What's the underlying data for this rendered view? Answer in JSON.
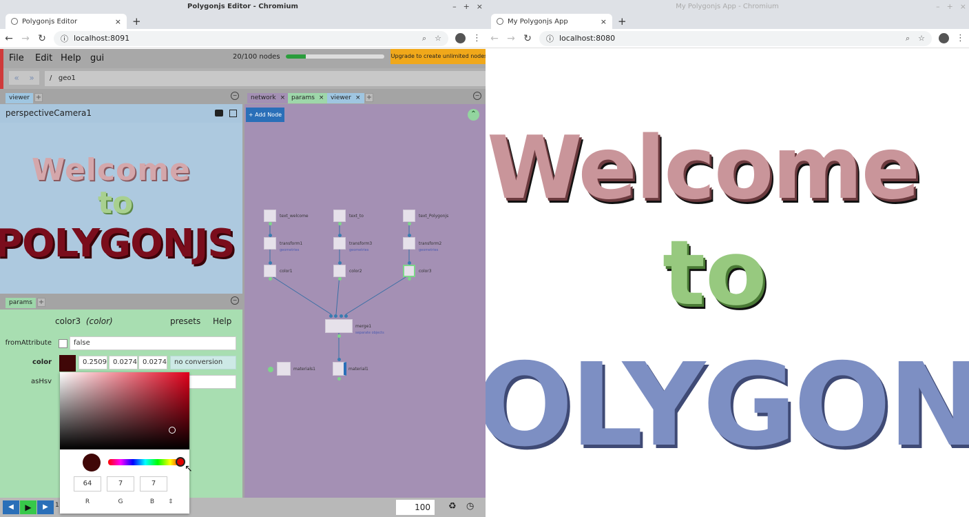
{
  "left_window": {
    "title": "Polygonjs Editor - Chromium",
    "tab_title": "Polygonjs Editor",
    "url": "localhost:8091"
  },
  "right_window": {
    "title": "My Polygonjs App - Chromium",
    "tab_title": "My Polygonjs App",
    "url": "localhost:8080",
    "scene_words": [
      "Welcome",
      "to",
      "POLYGONJS"
    ],
    "scene_shown": [
      "Welcome",
      "to",
      "OLYGON"
    ]
  },
  "window_controls": [
    "–",
    "+",
    "×"
  ],
  "menu": {
    "items": [
      "File",
      "Edit",
      "Help",
      "gui"
    ]
  },
  "node_count": {
    "text": "20/100 nodes",
    "fraction": 0.2
  },
  "upgrade_label": "Upgrade to create unlimited nodes ▸",
  "path": {
    "prefix": "/",
    "value": "geo1"
  },
  "viewer_panel": {
    "tab": "viewer",
    "camera": "perspectiveCamera1",
    "scene_words": [
      "Welcome",
      "to",
      "POLYGONJS"
    ]
  },
  "network_panel": {
    "tabs": [
      "network",
      "params",
      "viewer"
    ],
    "add_node": "+ Add Node",
    "nodes": [
      {
        "name": "text_welcome"
      },
      {
        "name": "text_to"
      },
      {
        "name": "text_Polygonjs"
      },
      {
        "name": "transform1",
        "sub": "geometries"
      },
      {
        "name": "transform3",
        "sub": "geometries"
      },
      {
        "name": "transform2",
        "sub": "geometries"
      },
      {
        "name": "color1"
      },
      {
        "name": "color2"
      },
      {
        "name": "color3"
      },
      {
        "name": "merge1",
        "sub": "separate objects"
      },
      {
        "name": "materials1"
      },
      {
        "name": "material1"
      }
    ]
  },
  "params_panel": {
    "tab": "params",
    "node_name": "color3",
    "node_type": "(color)",
    "presets": "presets",
    "help": "Help",
    "fromAttribute": {
      "label": "fromAttribute",
      "value": "false"
    },
    "color": {
      "label": "color",
      "values": [
        "0.25098",
        "0.02745",
        "0.02745"
      ],
      "conversion": "no conversion",
      "swatch": "#400707"
    },
    "asHsv": {
      "label": "asHsv"
    }
  },
  "color_picker": {
    "r": "64",
    "g": "7",
    "b": "7",
    "labels": [
      "R",
      "G",
      "B"
    ],
    "swatch": "#400707"
  },
  "bottom": {
    "frame": "100",
    "frame_start": "1"
  },
  "colors": {
    "welcome_pink": "#c9959a",
    "to_green": "#97c97f",
    "polygon_blue": "#7d8fc3",
    "polygon_dark_red": "#5a0a14",
    "network_bg": "#a490b4",
    "params_bg": "#a8deb1",
    "viewer_bg": "#adc9df",
    "accent_red": "#cf3a3a"
  }
}
